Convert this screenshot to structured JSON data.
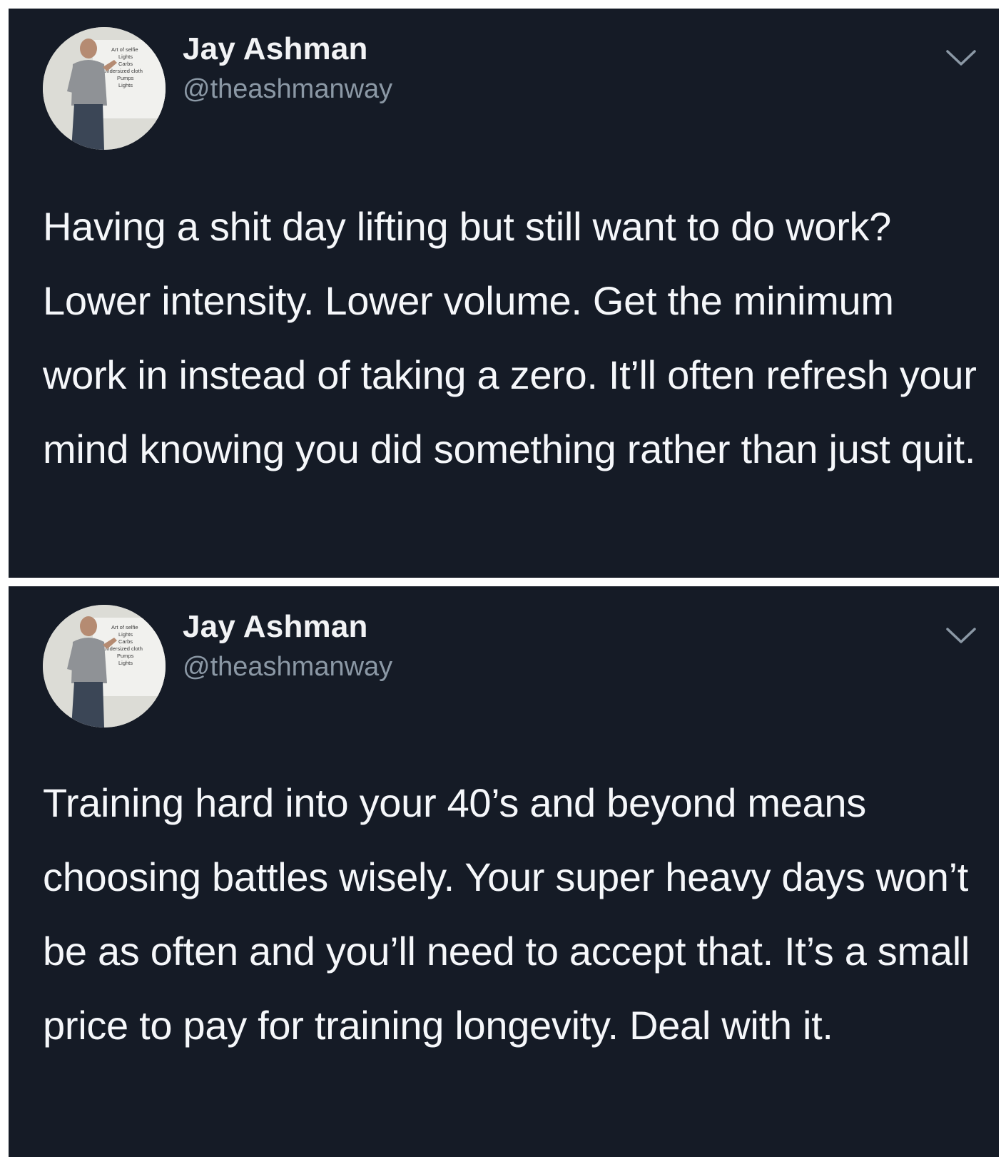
{
  "tweets": [
    {
      "author": {
        "display_name": "Jay Ashman",
        "handle": "@theashmanway",
        "avatar_board_text": [
          "Art of selfie",
          "Lights",
          "Carbs",
          "Undersized cloth",
          "Pumps",
          "Lights"
        ]
      },
      "text": "Having a shit day lifting but still want to do work? Lower intensity. Lower volume. Get the minimum work in instead of taking a zero. It’ll often refresh your mind knowing you did something rather than just quit.",
      "menu_icon": "chevron-down-icon"
    },
    {
      "author": {
        "display_name": "Jay Ashman",
        "handle": "@theashmanway",
        "avatar_board_text": [
          "Art of selfie",
          "Lights",
          "Carbs",
          "Undersized cloth",
          "Pumps",
          "Lights"
        ]
      },
      "text": "Training hard into your 40’s and beyond means choosing battles wisely. Your super heavy days won’t be as often and you’ll need to accept that. It’s a small price to pay for training longevity. Deal with it.",
      "menu_icon": "chevron-down-icon"
    }
  ],
  "colors": {
    "card_background": "#151b26",
    "name": "#f2f3f5",
    "handle": "#8b98a5",
    "text": "#f5f7fa",
    "separator": "#ffffff"
  }
}
